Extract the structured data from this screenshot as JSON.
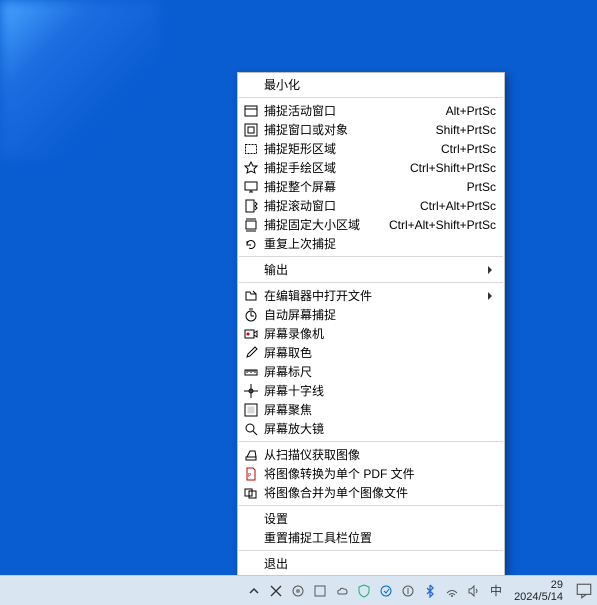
{
  "menu": {
    "minimize": "最小化",
    "capture": [
      {
        "label": "捕捉活动窗口",
        "shortcut": "Alt+PrtSc"
      },
      {
        "label": "捕捉窗口或对象",
        "shortcut": "Shift+PrtSc"
      },
      {
        "label": "捕捉矩形区域",
        "shortcut": "Ctrl+PrtSc"
      },
      {
        "label": "捕捉手绘区域",
        "shortcut": "Ctrl+Shift+PrtSc"
      },
      {
        "label": "捕捉整个屏幕",
        "shortcut": "PrtSc"
      },
      {
        "label": "捕捉滚动窗口",
        "shortcut": "Ctrl+Alt+PrtSc"
      },
      {
        "label": "捕捉固定大小区域",
        "shortcut": "Ctrl+Alt+Shift+PrtSc"
      },
      {
        "label": "重复上次捕捉",
        "shortcut": ""
      }
    ],
    "output": "输出",
    "open_in_editor": "在编辑器中打开文件",
    "tools": [
      "自动屏幕捕捉",
      "屏幕录像机",
      "屏幕取色",
      "屏幕标尺",
      "屏幕十字线",
      "屏幕聚焦",
      "屏幕放大镜"
    ],
    "batch": [
      "从扫描仪获取图像",
      "将图像转换为单个 PDF 文件",
      "将图像合并为单个图像文件"
    ],
    "settings": "设置",
    "reset_toolbar": "重置捕捉工具栏位置",
    "exit": "退出"
  },
  "taskbar": {
    "ime": "中",
    "time": "29",
    "date": "2024/5/14"
  }
}
